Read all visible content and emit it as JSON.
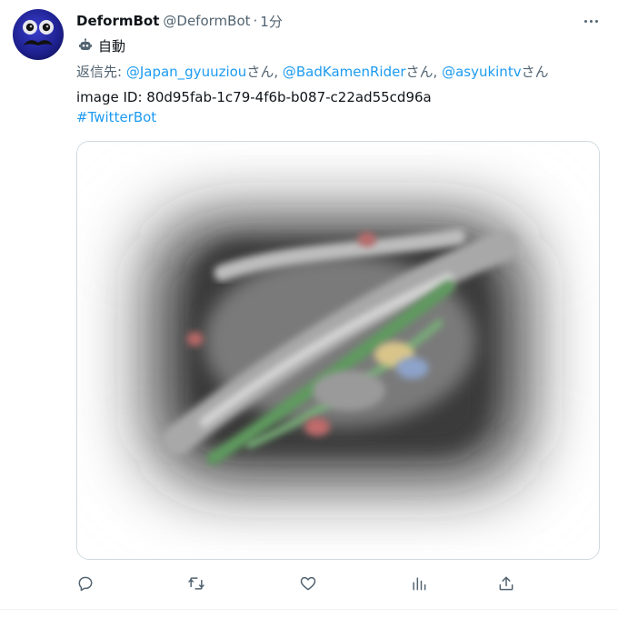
{
  "author": {
    "display_name": "DeformBot",
    "handle": "@DeformBot",
    "separator": "·",
    "time": "1分"
  },
  "automated_label": "自動",
  "reply": {
    "prefix": "返信先: ",
    "mentions": [
      "@Japan_gyuuziou",
      "@BadKamenRider",
      "@asyukintv"
    ],
    "honorific": "さん",
    "separator": ", "
  },
  "body": {
    "image_id_line": "image ID: 80d95fab-1c79-4f6b-b087-c22ad55cd96a",
    "hashtag": "#TwitterBot"
  },
  "icons": {
    "avatar": "mustache-face-avatar",
    "more": "more-horizontal-icon",
    "automated": "robot-icon",
    "reply": "reply-icon",
    "retweet": "retweet-icon",
    "like": "heart-icon",
    "views": "views-chart-icon",
    "share": "share-icon"
  },
  "colors": {
    "link": "#1d9bf0",
    "muted": "#536471",
    "text": "#0f1419",
    "border": "#cfd9de"
  }
}
